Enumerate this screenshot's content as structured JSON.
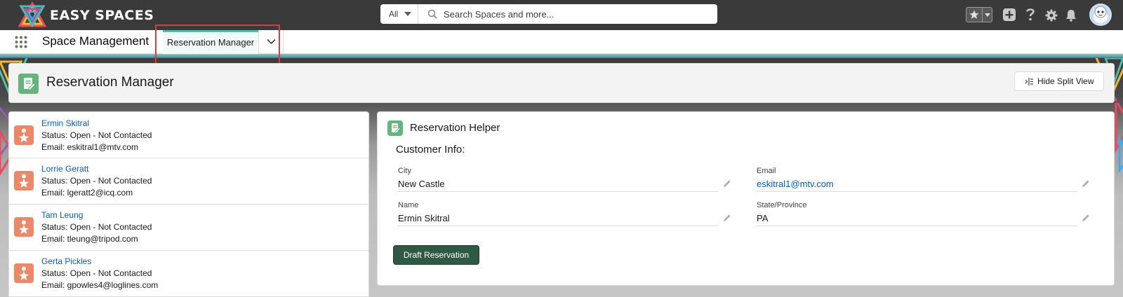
{
  "header": {
    "brand": "EASY SPACES",
    "search_scope": "All",
    "search_placeholder": "Search Spaces and more...",
    "icons": [
      "favorites-star-icon",
      "add-icon",
      "help-icon",
      "gear-icon",
      "bell-icon",
      "avatar"
    ]
  },
  "nav": {
    "app_name": "Space Management",
    "active_tab": "Reservation Manager"
  },
  "page_header": {
    "title": "Reservation Manager",
    "split_view_button": "Hide Split View"
  },
  "list": {
    "items": [
      {
        "name": "Ermin Skitral",
        "status": "Status: Open - Not Contacted",
        "email": "Email: eskitral1@mtv.com"
      },
      {
        "name": "Lorrie Geratt",
        "status": "Status: Open - Not Contacted",
        "email": "Email: lgeratt2@icq.com"
      },
      {
        "name": "Tam Leung",
        "status": "Status: Open - Not Contacted",
        "email": "Email: tleung@tripod.com"
      },
      {
        "name": "Gerta Pickles",
        "status": "Status: Open - Not Contacted",
        "email": "Email: gpowles4@loglines.com"
      }
    ]
  },
  "helper": {
    "title": "Reservation Helper",
    "section_title": "Customer Info:",
    "fields": {
      "city_label": "City",
      "city_value": "New Castle",
      "email_label": "Email",
      "email_value": "eskitral1@mtv.com",
      "name_label": "Name",
      "name_value": "Ermin Skitral",
      "state_label": "State/Province",
      "state_value": "PA"
    },
    "draft_button": "Draft Reservation"
  },
  "colors": {
    "header_bg": "#3a3a3a",
    "tab_accent": "#4bc0ad",
    "link": "#0b5cab",
    "lead_icon": "#e9896a",
    "page_icon": "#62b57c",
    "draft_button": "#2e5944"
  }
}
